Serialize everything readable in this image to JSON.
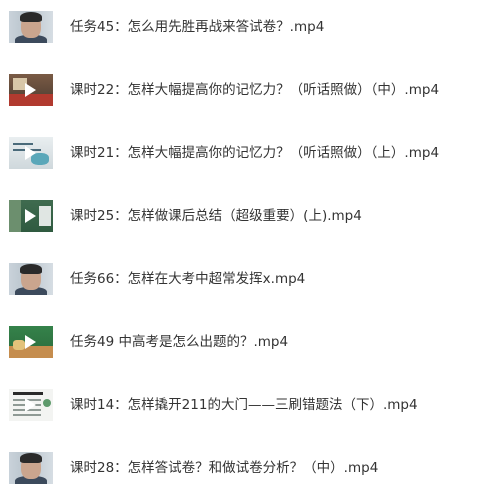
{
  "files": [
    {
      "name": "任务45：怎么用先胜再战来答试卷？.mp4",
      "thumbnail_icon": "video-thumbnail-person",
      "has_play_icon": false
    },
    {
      "name": "课时22：怎样大幅提高你的记忆力？（听话照做）（中）.mp4",
      "thumbnail_icon": "video-thumbnail",
      "has_play_icon": true
    },
    {
      "name": "课时21：怎样大幅提高你的记忆力？（听话照做）（上）.mp4",
      "thumbnail_icon": "video-thumbnail",
      "has_play_icon": true
    },
    {
      "name": "课时25：怎样做课后总结（超级重要）(上).mp4",
      "thumbnail_icon": "video-thumbnail",
      "has_play_icon": true
    },
    {
      "name": "任务66：怎样在大考中超常发挥x.mp4",
      "thumbnail_icon": "video-thumbnail-person",
      "has_play_icon": false
    },
    {
      "name": "任务49 中高考是怎么出题的？.mp4",
      "thumbnail_icon": "video-thumbnail",
      "has_play_icon": true
    },
    {
      "name": "课时14：怎样撬开211的大门——三刷错题法（下）.mp4",
      "thumbnail_icon": "video-thumbnail",
      "has_play_icon": true
    },
    {
      "name": "课时28：怎样答试卷？和做试卷分析？（中）.mp4",
      "thumbnail_icon": "video-thumbnail-person",
      "has_play_icon": false
    }
  ],
  "colors": {
    "text": "#333333",
    "background": "#ffffff",
    "play_icon": "#ffffff"
  }
}
